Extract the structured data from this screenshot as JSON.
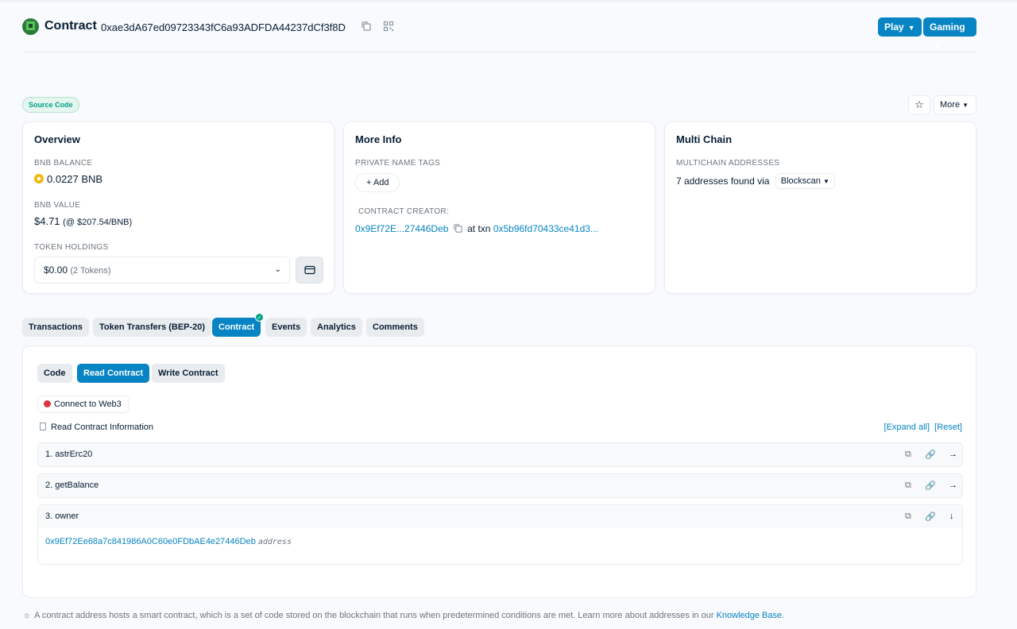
{
  "header": {
    "title": "Contract",
    "address": "0xae3dA67ed09723343fC6a93ADFDA44237dCf3f8D",
    "icons": [
      "copy-icon",
      "qr-code-icon"
    ],
    "buttons": [
      {
        "label": "Play"
      },
      {
        "label": "Gaming"
      }
    ]
  },
  "badge": "Source Code",
  "more_label": "More",
  "overview": {
    "title": "Overview",
    "bnb_balance_label": "BNB BALANCE",
    "bnb_balance": "0.0227 BNB",
    "bnb_value_label": "BNB VALUE",
    "bnb_value": "$4.71",
    "bnb_rate": "(@ $207.54/BNB)",
    "token_holdings_label": "TOKEN HOLDINGS",
    "token_value": "$0.00",
    "token_count": "(2 Tokens)"
  },
  "more_info": {
    "title": "More Info",
    "private_tags_label": "PRIVATE NAME TAGS",
    "add_label": "Add",
    "creator_label": "CONTRACT CREATOR:",
    "creator_address": "0x9Ef72E...27446Deb",
    "at_txn": "at txn",
    "txn_hash": "0x5b96fd70433ce41d3..."
  },
  "multi_chain": {
    "title": "Multi Chain",
    "label": "MULTICHAIN ADDRESSES",
    "found_text": "7 addresses found via",
    "source": "Blockscan"
  },
  "tabs": [
    {
      "label": "Transactions"
    },
    {
      "label": "Token Transfers (BEP-20)"
    },
    {
      "label": "Contract"
    },
    {
      "label": "Events"
    },
    {
      "label": "Analytics"
    },
    {
      "label": "Comments"
    }
  ],
  "subtabs": [
    {
      "label": "Code"
    },
    {
      "label": "Read Contract"
    },
    {
      "label": "Write Contract"
    }
  ],
  "connect_label": "Connect to Web3",
  "read_info_label": "Read Contract Information",
  "expand_all": "[Expand all]",
  "reset": "[Reset]",
  "functions": [
    {
      "name": "1. astrErc20"
    },
    {
      "name": "2. getBalance"
    },
    {
      "name": "3. owner"
    }
  ],
  "owner_result": {
    "value": "0x9Ef72Ee68a7c841986A0C60e0FDbAE4e27446Deb",
    "type": "address"
  },
  "footer": {
    "text": "A contract address hosts a smart contract, which is a set of code stored on the blockchain that runs when predetermined conditions are met. Learn more about addresses in our",
    "link": "Knowledge Base",
    "end": "."
  },
  "colors": {
    "primary": "#0784c3",
    "success": "#00a186",
    "danger": "#dc3545"
  }
}
